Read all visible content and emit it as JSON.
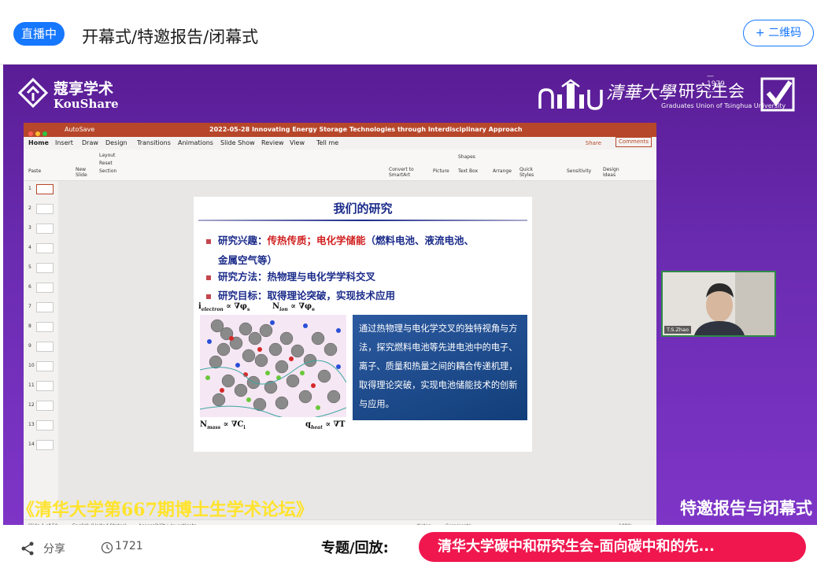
{
  "header": {
    "live_badge": "直播中",
    "title": "开幕式/特邀报告/闭幕式",
    "qr_button": "+ 二维码"
  },
  "stage": {
    "left_brand_cn": "蔻享学术",
    "left_brand_en": "KouShare",
    "right_brand_tsinghua": "清華大學",
    "right_brand_union": "研究生会",
    "right_brand_year": "—1979—",
    "right_brand_sub": "Graduates Union of Tsinghua University",
    "forum_title": "《清华大学第667期博士生学术论坛》",
    "session_title": "特邀报告与闭幕式"
  },
  "ppt": {
    "autosave": "AutoSave",
    "doc_title": "2022-05-28 Innovating Energy Storage Technologies through Interdisciplinary Approach",
    "tabs": [
      "Home",
      "Insert",
      "Draw",
      "Design",
      "Transitions",
      "Animations",
      "Slide Show",
      "Review",
      "View",
      "Tell me"
    ],
    "share": "Share",
    "comments": "Comments",
    "ribbon": {
      "paste": "Paste",
      "new_slide": "New Slide",
      "layout": "Layout",
      "reset": "Reset",
      "section": "Section",
      "convert": "Convert to SmartArt",
      "picture": "Picture",
      "shapes": "Shapes",
      "text_box": "Text Box",
      "arrange": "Arrange",
      "quick_styles": "Quick Styles",
      "sensitivity": "Sensitivity",
      "design_ideas": "Design Ideas"
    },
    "thumb_numbers": [
      "1",
      "2",
      "3",
      "4",
      "5",
      "6",
      "7",
      "8",
      "9",
      "10",
      "11",
      "12",
      "13",
      "14"
    ],
    "status": {
      "slide_of": "Slide 1 of 50",
      "language": "English (United States)",
      "accessibility": "Accessibility: Investigate",
      "notes": "Notes",
      "comments": "Comments",
      "zoom": "108%"
    }
  },
  "slide": {
    "title": "我们的研究",
    "b1_label": "研究兴趣：",
    "b1_red": "传热传质；电化学储能",
    "b1_rest": "（燃料电池、液流电池、",
    "b1_cont": "金属空气等）",
    "b2": "研究方法：热物理与电化学学科交叉",
    "b3": "研究目标：取得理论突破，实现技术应用",
    "box_text": "通过热物理与电化学交叉的独特视角与方法，探究燃料电池等先进电池中的电子、离子、质量和热量之间的耦合传递机理，取得理论突破，实现电池储能技术的创新与应用。",
    "eq_i": "i",
    "eq_i_sub": "electron",
    "eq_i_rest": "∝ ∇φ",
    "eq_i_rest_sub": "s",
    "eq_n": "N",
    "eq_n_sub": "ion",
    "eq_n_rest": "∝ ∇φ",
    "eq_n_rest_sub": "e",
    "eq_m": "N",
    "eq_m_sub": "mass",
    "eq_m_rest": "∝ ∇C",
    "eq_m_rest_sub": "i",
    "eq_q": "q",
    "eq_q_sub": "heat",
    "eq_q_rest": "∝ ∇T"
  },
  "speaker": {
    "name": "T.S.Zhao"
  },
  "footer": {
    "share": "分享",
    "views": "1721",
    "topic_label": "专题/回放:",
    "topic_button": "清华大学碳中和研究生会-面向碳中和的先..."
  }
}
